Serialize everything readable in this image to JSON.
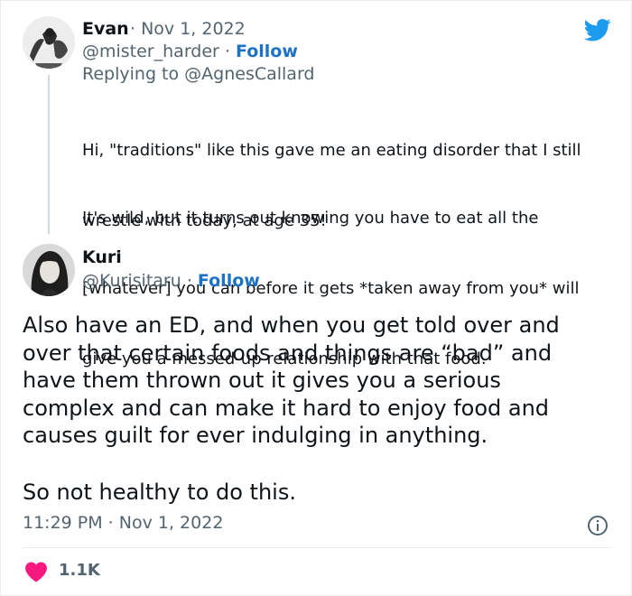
{
  "tweet1": {
    "name": "Evan",
    "date": "Nov 1, 2022",
    "handle": "@mister_harder",
    "follow": "Follow",
    "reply_prefix": "Replying to ",
    "reply_handle": "@AgnesCallard",
    "para1_line1": "Hi, \"traditions\" like this gave me an eating disorder that I still",
    "para1_line2": "wrestle with today, at age 35!",
    "para2_line1": "It's wild, but it turns out knowing you have to eat all the",
    "para2_line2": "[whatever] you can before it gets *taken away from you* will",
    "para2_line3": "give you a messed-up relationship with that food."
  },
  "tweet2": {
    "name": "Kuri",
    "handle": "@Kurisitaru",
    "follow": "Follow",
    "line1": "Also have an ED, and when you get told over and",
    "line2": "over that certain foods and things are “bad” and",
    "line3": "have them thrown out it gives you a serious",
    "line4": "complex and can make it hard to enjoy food and",
    "line5": "causes guilt for ever indulging in anything.",
    "line6": "So not healthy to do this.",
    "timestamp": "11:29 PM · Nov 1, 2022",
    "likes": "1.1K"
  },
  "colors": {
    "twitter_blue": "#1d9bf0",
    "follow_blue": "#1d72c7",
    "heart_red": "#f91880",
    "muted": "#536471"
  },
  "icons": [
    "twitter-bird-icon",
    "info-icon",
    "heart-icon"
  ]
}
